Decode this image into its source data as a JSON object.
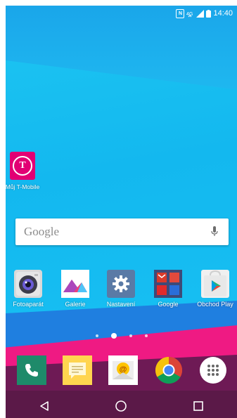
{
  "status": {
    "time": "14:40",
    "nfc": "N"
  },
  "home_icons": {
    "t_mobile": {
      "label": "Můj T-Mobile",
      "glyph": "T"
    }
  },
  "search": {
    "placeholder": "Google"
  },
  "apps": [
    {
      "label": "Fotoaparát",
      "icon": "camera-icon"
    },
    {
      "label": "Galerie",
      "icon": "gallery-icon"
    },
    {
      "label": "Nastavení",
      "icon": "settings-icon"
    },
    {
      "label": "Google",
      "icon": "google-folder-icon"
    },
    {
      "label": "Obchod Play",
      "icon": "play-store-icon"
    }
  ],
  "page_indicator": {
    "count": 4,
    "active": 1
  },
  "dock": [
    "phone-icon",
    "messages-icon",
    "email-icon",
    "chrome-icon",
    "apps-drawer-icon"
  ],
  "colors": {
    "t_mobile": "#e20074",
    "sky": "#19c3f4",
    "pink": "#ef1a83",
    "purple": "#6e1a55"
  }
}
